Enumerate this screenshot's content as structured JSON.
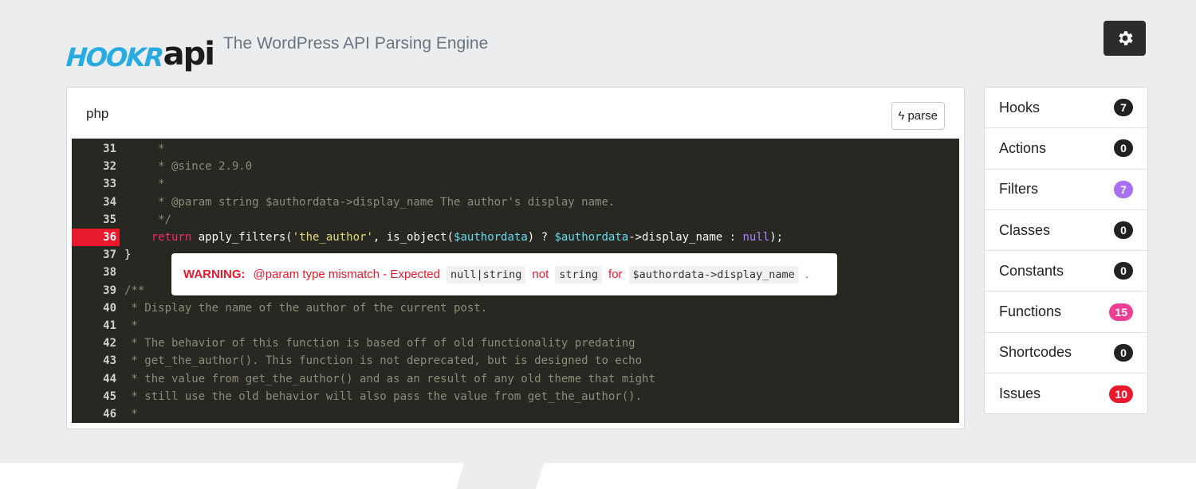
{
  "brand": {
    "logo_text_part1": "HOOKR",
    "logo_text_part2": "api",
    "tagline": "The WordPress API Parsing Engine"
  },
  "header": {
    "settings_icon": "gear-icon"
  },
  "editor": {
    "language": "php",
    "parse_label": "parse",
    "parse_icon": "bolt-icon",
    "lines": [
      {
        "n": "31",
        "tokens": [
          [
            "c-com",
            "     *"
          ]
        ]
      },
      {
        "n": "32",
        "tokens": [
          [
            "c-com",
            "     * @since 2.9.0"
          ]
        ]
      },
      {
        "n": "33",
        "tokens": [
          [
            "c-com",
            "     *"
          ]
        ]
      },
      {
        "n": "34",
        "tokens": [
          [
            "c-com",
            "     * @param string $authordata->display_name The author's display name."
          ]
        ]
      },
      {
        "n": "35",
        "tokens": [
          [
            "c-com",
            "     */"
          ]
        ]
      },
      {
        "n": "36",
        "error": true,
        "tokens": [
          [
            "c-plain",
            "    "
          ],
          [
            "c-kw",
            "return"
          ],
          [
            "c-plain",
            " apply_filters("
          ],
          [
            "c-str",
            "'the_author'"
          ],
          [
            "c-plain",
            ", is_object("
          ],
          [
            "c-var",
            "$authordata"
          ],
          [
            "c-plain",
            ") ? "
          ],
          [
            "c-var",
            "$authordata"
          ],
          [
            "c-plain",
            "->display_name : "
          ],
          [
            "c-null",
            "null"
          ],
          [
            "c-plain",
            ");"
          ]
        ]
      },
      {
        "n": "37",
        "tokens": [
          [
            "c-plain",
            "}"
          ]
        ]
      },
      {
        "n": "38",
        "tokens": []
      },
      {
        "n": "39",
        "tokens": [
          [
            "c-com",
            "/**"
          ]
        ]
      },
      {
        "n": "40",
        "tokens": [
          [
            "c-com",
            " * Display the name of the author of the current post."
          ]
        ]
      },
      {
        "n": "41",
        "tokens": [
          [
            "c-com",
            " *"
          ]
        ]
      },
      {
        "n": "42",
        "tokens": [
          [
            "c-com",
            " * The behavior of this function is based off of old functionality predating"
          ]
        ]
      },
      {
        "n": "43",
        "tokens": [
          [
            "c-com",
            " * get_the_author(). This function is not deprecated, but is designed to echo"
          ]
        ]
      },
      {
        "n": "44",
        "tokens": [
          [
            "c-com",
            " * the value from get_the_author() and as an result of any old theme that might"
          ]
        ]
      },
      {
        "n": "45",
        "tokens": [
          [
            "c-com",
            " * still use the old behavior will also pass the value from get_the_author()."
          ]
        ]
      },
      {
        "n": "46",
        "tokens": [
          [
            "c-com",
            " *"
          ]
        ]
      }
    ],
    "warning": {
      "label": "WARNING",
      "colon": ":",
      "message": "@param type mismatch - Expected",
      "expected": "null|string",
      "not_word": "not",
      "actual": "string",
      "for_word": "for",
      "target": "$authordata->display_name",
      "period": "."
    }
  },
  "sidebar": {
    "items": [
      {
        "label": "Hooks",
        "count": "7",
        "color": "#222222"
      },
      {
        "label": "Actions",
        "count": "0",
        "color": "#222222"
      },
      {
        "label": "Filters",
        "count": "7",
        "color": "#a86ff0"
      },
      {
        "label": "Classes",
        "count": "0",
        "color": "#222222"
      },
      {
        "label": "Constants",
        "count": "0",
        "color": "#222222"
      },
      {
        "label": "Functions",
        "count": "15",
        "color": "#ef3f95"
      },
      {
        "label": "Shortcodes",
        "count": "0",
        "color": "#222222"
      },
      {
        "label": "Issues",
        "count": "10",
        "color": "#e8192c"
      }
    ]
  }
}
